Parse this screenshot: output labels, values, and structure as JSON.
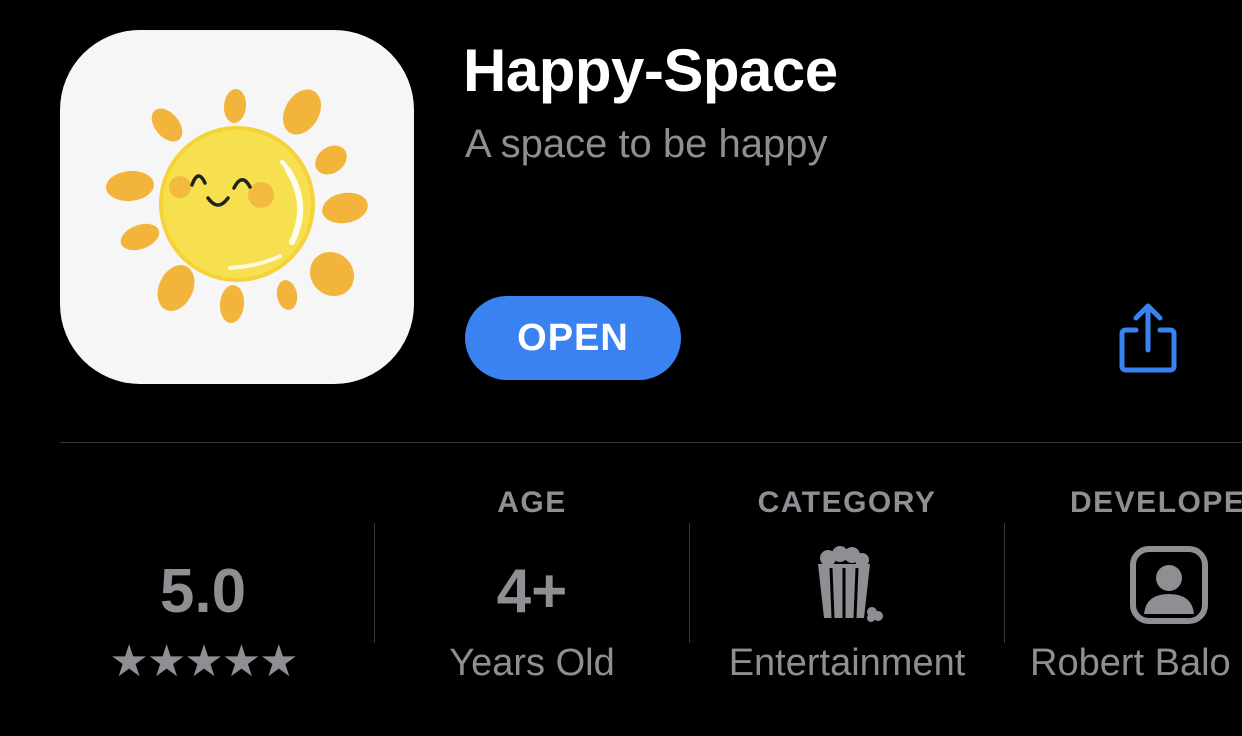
{
  "app": {
    "name": "Happy-Space",
    "subtitle": "A space to be happy",
    "icon": "smiling-sun-icon"
  },
  "actions": {
    "open_label": "OPEN",
    "share_icon": "share-icon"
  },
  "info": {
    "rating": {
      "value": "5.0",
      "stars": "★★★★★",
      "star_count": 5
    },
    "age": {
      "header": "AGE",
      "value": "4+",
      "caption": "Years Old"
    },
    "category": {
      "header": "CATEGORY",
      "icon": "popcorn-icon",
      "caption": "Entertainment"
    },
    "developer": {
      "header": "DEVELOPE",
      "icon": "person-icon",
      "caption": "Robert Balo"
    }
  },
  "colors": {
    "background": "#000000",
    "accent": "#3b82f1",
    "secondary_text": "#8e8e93",
    "sun_yellow": "#f7e050",
    "sun_orange": "#f2b43a"
  }
}
